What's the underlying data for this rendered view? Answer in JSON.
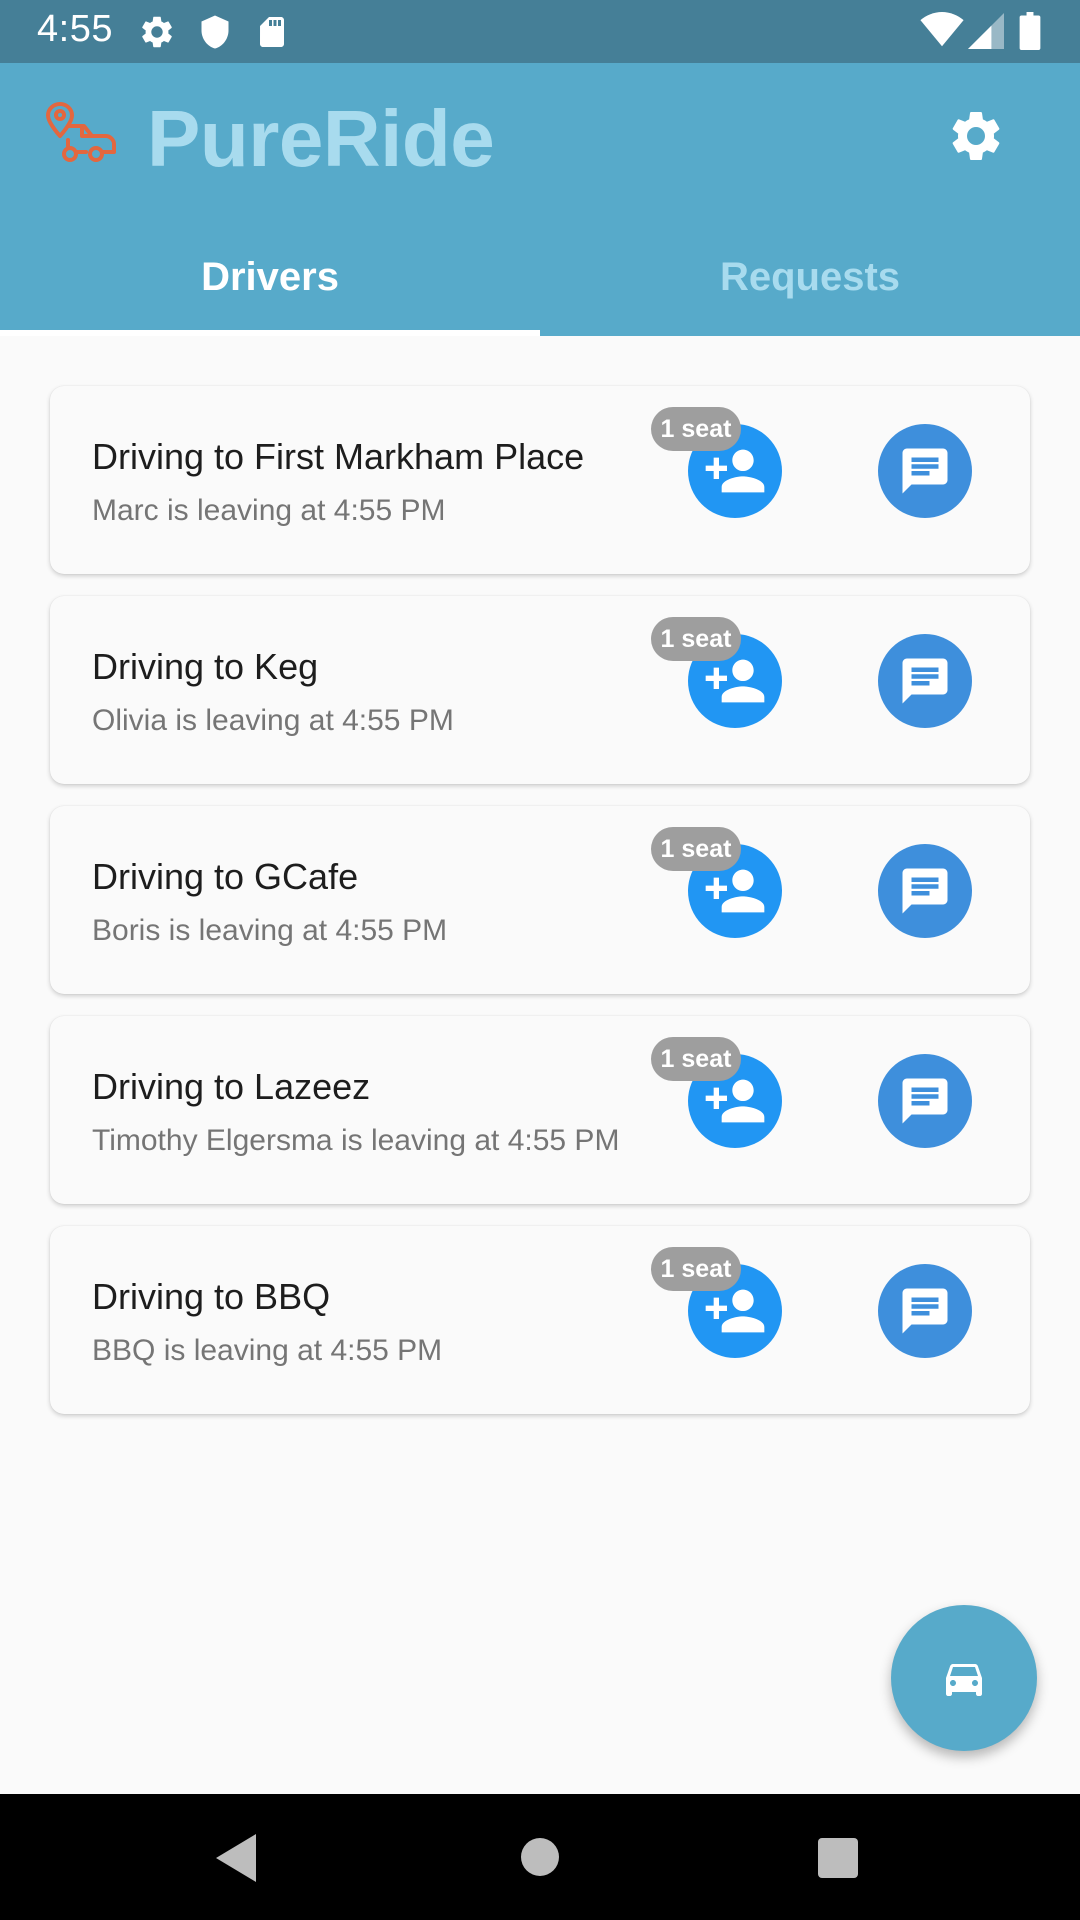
{
  "status_bar": {
    "time": "4:55",
    "left_icons": [
      "gear-icon",
      "shield-icon",
      "sd-card-icon"
    ],
    "right_icons": [
      "wifi-icon",
      "cell-signal-icon",
      "battery-icon"
    ]
  },
  "app_bar": {
    "logo_icon": "car-location-icon",
    "title": "PureRide",
    "settings_icon": "gear-icon",
    "title_color": "#a8dbee",
    "background_color": "#57aaca"
  },
  "tabs": [
    {
      "label": "Drivers",
      "selected": true
    },
    {
      "label": "Requests",
      "selected": false
    }
  ],
  "rides": [
    {
      "title": "Driving to First Markham Place",
      "subtitle": "Marc is leaving at 4:55 PM",
      "seats": "1 seat"
    },
    {
      "title": "Driving to Keg",
      "subtitle": "Olivia is leaving at 4:55 PM",
      "seats": "1 seat"
    },
    {
      "title": "Driving to GCafe",
      "subtitle": "Boris is leaving at 4:55 PM",
      "seats": "1 seat"
    },
    {
      "title": "Driving to Lazeez",
      "subtitle": "Timothy Elgersma is leaving at 4:55 PM",
      "seats": "1 seat"
    },
    {
      "title": "Driving to BBQ",
      "subtitle": "BBQ is leaving at 4:55 PM",
      "seats": "1 seat"
    }
  ],
  "ride_actions": {
    "join_icon": "person-add-icon",
    "chat_icon": "chat-icon",
    "join_color": "#2196f3",
    "chat_color": "#3e8fdc"
  },
  "fab": {
    "icon": "car-icon"
  },
  "nav_bar": {
    "icons": [
      "back-icon",
      "home-icon",
      "recents-icon"
    ]
  }
}
